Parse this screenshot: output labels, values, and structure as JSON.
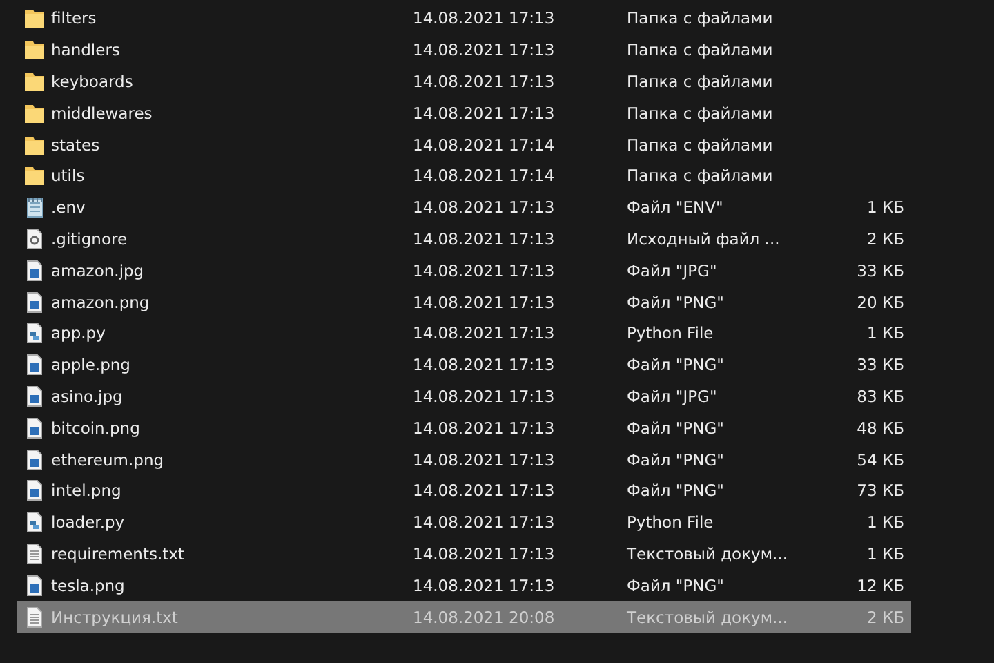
{
  "files": [
    {
      "kind": "folder",
      "name": "filters",
      "date": "14.08.2021 17:13",
      "type": "Папка с файлами",
      "selected": false
    },
    {
      "kind": "folder",
      "name": "handlers",
      "date": "14.08.2021 17:13",
      "type": "Папка с файлами",
      "selected": false
    },
    {
      "kind": "folder",
      "name": "keyboards",
      "date": "14.08.2021 17:13",
      "type": "Папка с файлами",
      "selected": false
    },
    {
      "kind": "folder",
      "name": "middlewares",
      "date": "14.08.2021 17:13",
      "type": "Папка с файлами",
      "selected": false
    },
    {
      "kind": "folder",
      "name": "states",
      "date": "14.08.2021 17:14",
      "type": "Папка с файлами",
      "selected": false
    },
    {
      "kind": "folder",
      "name": "utils",
      "date": "14.08.2021 17:14",
      "type": "Папка с файлами",
      "selected": false
    },
    {
      "kind": "notepad",
      "name": ".env",
      "date": "14.08.2021 17:13",
      "type": "Файл \"ENV\"",
      "size": "1 КБ",
      "selected": false
    },
    {
      "kind": "config",
      "name": ".gitignore",
      "date": "14.08.2021 17:13",
      "type": "Исходный файл ...",
      "size": "2 КБ",
      "selected": false
    },
    {
      "kind": "image",
      "name": "amazon.jpg",
      "date": "14.08.2021 17:13",
      "type": "Файл \"JPG\"",
      "size": "33 КБ",
      "selected": false
    },
    {
      "kind": "image",
      "name": "amazon.png",
      "date": "14.08.2021 17:13",
      "type": "Файл \"PNG\"",
      "size": "20 КБ",
      "selected": false
    },
    {
      "kind": "python",
      "name": "app.py",
      "date": "14.08.2021 17:13",
      "type": "Python File",
      "size": "1 КБ",
      "selected": false
    },
    {
      "kind": "image",
      "name": "apple.png",
      "date": "14.08.2021 17:13",
      "type": "Файл \"PNG\"",
      "size": "33 КБ",
      "selected": false
    },
    {
      "kind": "image",
      "name": "asino.jpg",
      "date": "14.08.2021 17:13",
      "type": "Файл \"JPG\"",
      "size": "83 КБ",
      "selected": false
    },
    {
      "kind": "image",
      "name": "bitcoin.png",
      "date": "14.08.2021 17:13",
      "type": "Файл \"PNG\"",
      "size": "48 КБ",
      "selected": false
    },
    {
      "kind": "image",
      "name": "ethereum.png",
      "date": "14.08.2021 17:13",
      "type": "Файл \"PNG\"",
      "size": "54 КБ",
      "selected": false
    },
    {
      "kind": "image",
      "name": "intel.png",
      "date": "14.08.2021 17:13",
      "type": "Файл \"PNG\"",
      "size": "73 КБ",
      "selected": false
    },
    {
      "kind": "python",
      "name": "loader.py",
      "date": "14.08.2021 17:13",
      "type": "Python File",
      "size": "1 КБ",
      "selected": false
    },
    {
      "kind": "text",
      "name": "requirements.txt",
      "date": "14.08.2021 17:13",
      "type": "Текстовый докум...",
      "size": "1 КБ",
      "selected": false
    },
    {
      "kind": "image",
      "name": "tesla.png",
      "date": "14.08.2021 17:13",
      "type": "Файл \"PNG\"",
      "size": "12 КБ",
      "selected": false
    },
    {
      "kind": "text",
      "name": "Инструкция.txt",
      "date": "14.08.2021 20:08",
      "type": "Текстовый докум...",
      "size": "2 КБ",
      "selected": true
    }
  ]
}
